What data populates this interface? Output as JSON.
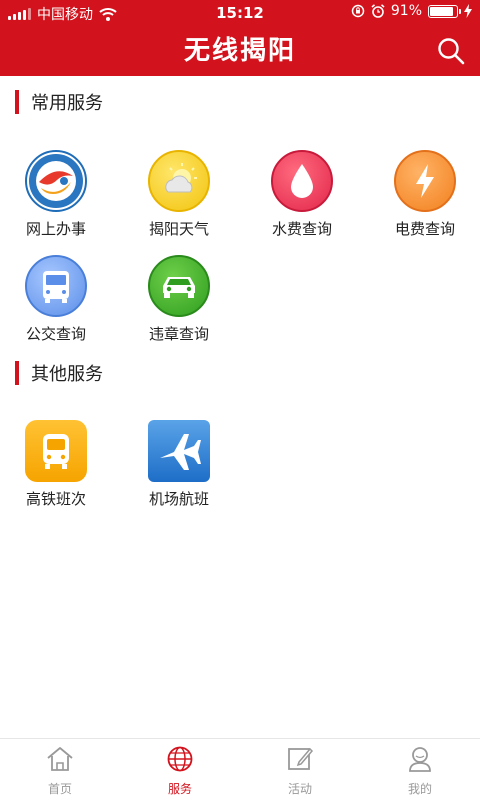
{
  "status_bar": {
    "carrier": "中国移动",
    "time": "15:12",
    "battery_text": "91%",
    "battery_level": 0.91,
    "icons": [
      "signal-icon",
      "wifi-icon",
      "rotation-lock-icon",
      "alarm-icon",
      "battery-icon",
      "charging-icon"
    ]
  },
  "header": {
    "title": "无线揭阳",
    "search_icon": "search-icon",
    "background": "#d2131d"
  },
  "sections": [
    {
      "title": "常用服务",
      "items": [
        {
          "label": "网上办事",
          "icon": "online-services-logo"
        },
        {
          "label": "揭阳天气",
          "icon": "weather-icon"
        },
        {
          "label": "水费查询",
          "icon": "water-drop-icon"
        },
        {
          "label": "电费查询",
          "icon": "lightning-icon"
        },
        {
          "label": "公交查询",
          "icon": "bus-icon"
        },
        {
          "label": "违章查询",
          "icon": "car-icon"
        }
      ]
    },
    {
      "title": "其他服务",
      "items": [
        {
          "label": "高铁班次",
          "icon": "train-icon"
        },
        {
          "label": "机场航班",
          "icon": "airplane-icon"
        }
      ]
    }
  ],
  "tabbar": {
    "active": 1,
    "tabs": [
      {
        "label": "首页",
        "icon": "home-icon"
      },
      {
        "label": "服务",
        "icon": "globe-icon"
      },
      {
        "label": "活动",
        "icon": "edit-icon"
      },
      {
        "label": "我的",
        "icon": "user-icon"
      }
    ]
  },
  "colors": {
    "accent": "#d2131d",
    "tab_inactive": "#999999"
  }
}
